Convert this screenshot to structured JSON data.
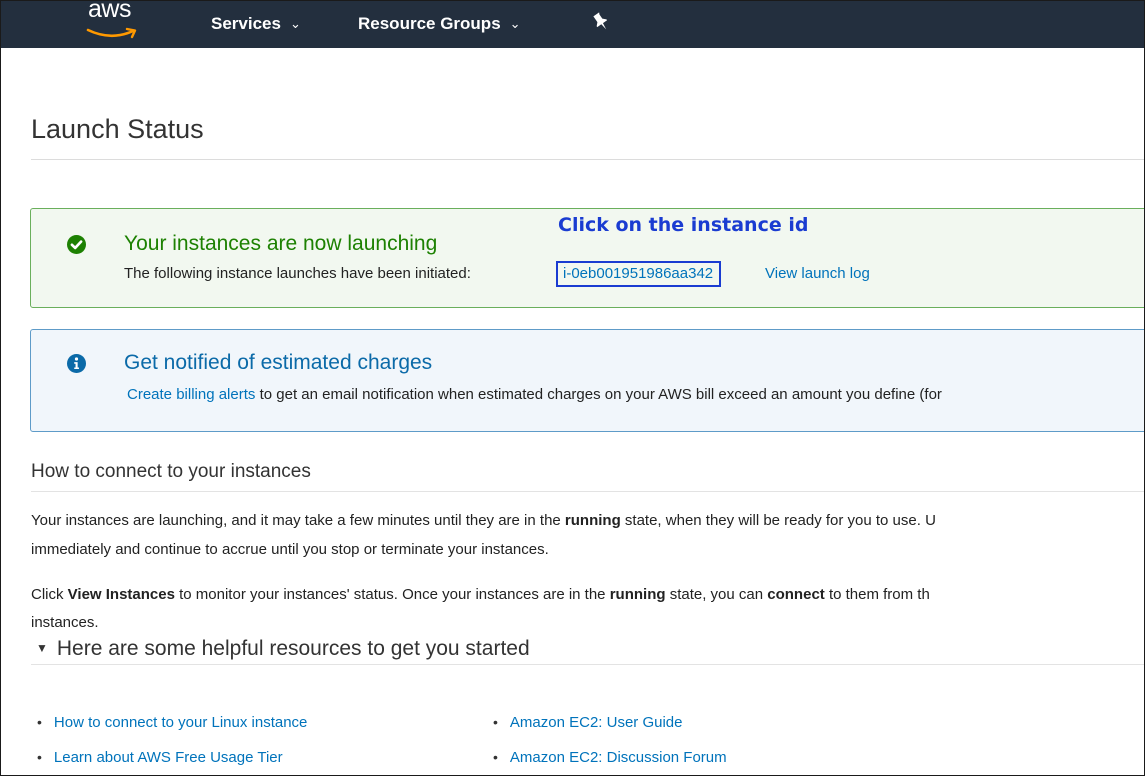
{
  "nav": {
    "logo_text": "aws",
    "items": [
      {
        "label": "Services",
        "chevron": "⌄"
      },
      {
        "label": "Resource Groups",
        "chevron": "⌄"
      }
    ],
    "pin_icon": "pin-icon"
  },
  "page": {
    "title": "Launch Status"
  },
  "annotation": "Click on the instance id",
  "success": {
    "title": "Your instances are now launching",
    "text": "The following instance launches have been initiated:",
    "instance_id": "i-0eb001951986aa342",
    "launch_log": "View launch log",
    "icon": "check-circle-icon",
    "color": "#1d8102"
  },
  "info": {
    "title": "Get notified of estimated charges",
    "link": "Create billing alerts",
    "text": "to get an email notification when estimated charges on your AWS bill exceed an amount you define (for",
    "icon": "info-circle-icon",
    "color": "#0b6aa8"
  },
  "connect": {
    "heading": "How to connect to your instances",
    "p1_line1_a": "Your instances are launching, and it may take a few minutes until they are in the ",
    "p1_line1_b": "running",
    "p1_line1_c": " state, when they will be ready for you to use. U",
    "p1_line2": "immediately and continue to accrue until you stop or terminate your instances.",
    "p2_line1_a": "Click ",
    "p2_line1_b": "View Instances",
    "p2_line1_c": " to monitor your instances' status. Once your instances are in the ",
    "p2_line1_d": "running",
    "p2_line1_e": " state, you can ",
    "p2_line1_f": "connect",
    "p2_line1_g": " to them from th",
    "p2_line2": "instances."
  },
  "resources": {
    "heading": "Here are some helpful resources to get you started",
    "toggle": "▼",
    "bullet": "•",
    "left": [
      "How to connect to your Linux instance",
      "Learn about AWS Free Usage Tier"
    ],
    "right": [
      "Amazon EC2: User Guide",
      "Amazon EC2: Discussion Forum"
    ]
  },
  "colors": {
    "nav_bg": "#232f3e",
    "link": "#0073bb",
    "annotation": "#1a3cd1"
  }
}
